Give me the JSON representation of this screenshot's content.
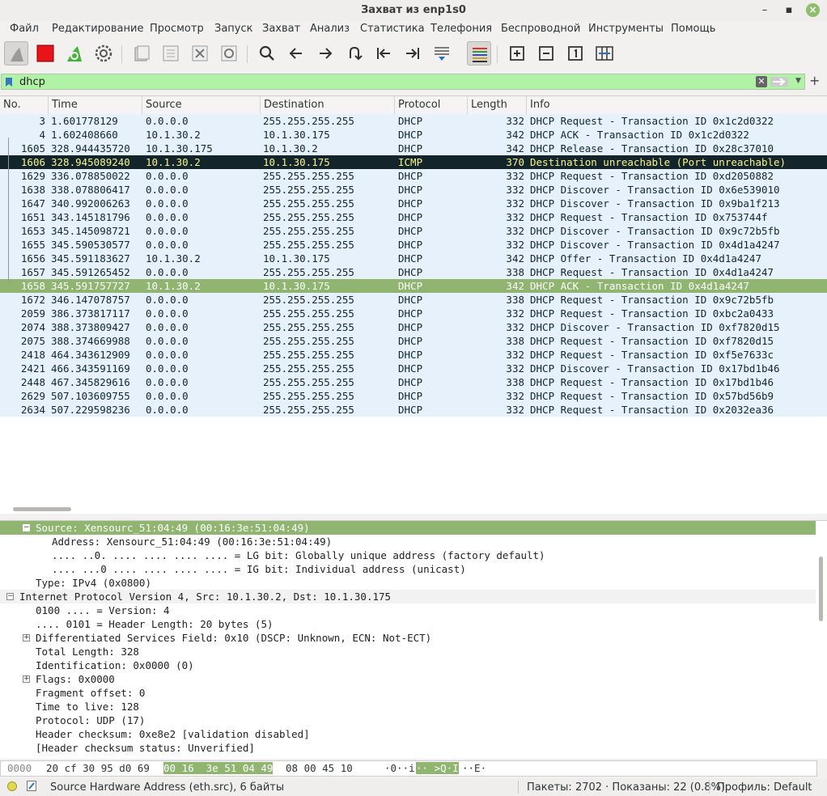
{
  "window": {
    "title": "Захват из enp1s0",
    "min": "–",
    "max": "▪",
    "close": "×"
  },
  "menu": [
    "Файл",
    "Редактирование",
    "Просмотр",
    "Запуск",
    "Захват",
    "Анализ",
    "Статистика",
    "Телефония",
    "Беспроводной",
    "Инструменты",
    "Помощь"
  ],
  "filter": {
    "value": "dhcp",
    "clear": "✕"
  },
  "packet_list": {
    "columns": [
      "No.",
      "Time",
      "Source",
      "Destination",
      "Protocol",
      "Length",
      "Info"
    ],
    "rows": [
      {
        "no": "3",
        "time": "1.601778129",
        "src": "0.0.0.0",
        "dst": "255.255.255.255",
        "proto": "DHCP",
        "len": "332",
        "info": "DHCP Request  - Transaction ID 0x1c2d0322"
      },
      {
        "no": "4",
        "time": "1.602408660",
        "src": "10.1.30.2",
        "dst": "10.1.30.175",
        "proto": "DHCP",
        "len": "342",
        "info": "DHCP ACK      - Transaction ID 0x1c2d0322"
      },
      {
        "no": "1605",
        "time": "328.944435720",
        "src": "10.1.30.175",
        "dst": "10.1.30.2",
        "proto": "DHCP",
        "len": "342",
        "info": "DHCP Release  - Transaction ID 0x28c37010"
      },
      {
        "no": "1606",
        "time": "328.945089240",
        "src": "10.1.30.2",
        "dst": "10.1.30.175",
        "proto": "ICMP",
        "len": "370",
        "info": "Destination unreachable (Port unreachable)"
      },
      {
        "no": "1629",
        "time": "336.078850022",
        "src": "0.0.0.0",
        "dst": "255.255.255.255",
        "proto": "DHCP",
        "len": "332",
        "info": "DHCP Request  - Transaction ID 0xd2050882"
      },
      {
        "no": "1638",
        "time": "338.078806417",
        "src": "0.0.0.0",
        "dst": "255.255.255.255",
        "proto": "DHCP",
        "len": "332",
        "info": "DHCP Discover - Transaction ID 0x6e539010"
      },
      {
        "no": "1647",
        "time": "340.992006263",
        "src": "0.0.0.0",
        "dst": "255.255.255.255",
        "proto": "DHCP",
        "len": "332",
        "info": "DHCP Discover - Transaction ID 0x9ba1f213"
      },
      {
        "no": "1651",
        "time": "343.145181796",
        "src": "0.0.0.0",
        "dst": "255.255.255.255",
        "proto": "DHCP",
        "len": "332",
        "info": "DHCP Request  - Transaction ID 0x753744f"
      },
      {
        "no": "1653",
        "time": "345.145098721",
        "src": "0.0.0.0",
        "dst": "255.255.255.255",
        "proto": "DHCP",
        "len": "332",
        "info": "DHCP Discover - Transaction ID 0x9c72b5fb"
      },
      {
        "no": "1655",
        "time": "345.590530577",
        "src": "0.0.0.0",
        "dst": "255.255.255.255",
        "proto": "DHCP",
        "len": "332",
        "info": "DHCP Discover - Transaction ID 0x4d1a4247"
      },
      {
        "no": "1656",
        "time": "345.591183627",
        "src": "10.1.30.2",
        "dst": "10.1.30.175",
        "proto": "DHCP",
        "len": "342",
        "info": "DHCP Offer    - Transaction ID 0x4d1a4247"
      },
      {
        "no": "1657",
        "time": "345.591265452",
        "src": "0.0.0.0",
        "dst": "255.255.255.255",
        "proto": "DHCP",
        "len": "338",
        "info": "DHCP Request  - Transaction ID 0x4d1a4247"
      },
      {
        "no": "1658",
        "time": "345.591757727",
        "src": "10.1.30.2",
        "dst": "10.1.30.175",
        "proto": "DHCP",
        "len": "342",
        "info": "DHCP ACK      - Transaction ID 0x4d1a4247"
      },
      {
        "no": "1672",
        "time": "346.147078757",
        "src": "0.0.0.0",
        "dst": "255.255.255.255",
        "proto": "DHCP",
        "len": "338",
        "info": "DHCP Request  - Transaction ID 0x9c72b5fb"
      },
      {
        "no": "2059",
        "time": "386.373817117",
        "src": "0.0.0.0",
        "dst": "255.255.255.255",
        "proto": "DHCP",
        "len": "332",
        "info": "DHCP Request  - Transaction ID 0xbc2a0433"
      },
      {
        "no": "2074",
        "time": "388.373809427",
        "src": "0.0.0.0",
        "dst": "255.255.255.255",
        "proto": "DHCP",
        "len": "332",
        "info": "DHCP Discover - Transaction ID 0xf7820d15"
      },
      {
        "no": "2075",
        "time": "388.374669988",
        "src": "0.0.0.0",
        "dst": "255.255.255.255",
        "proto": "DHCP",
        "len": "338",
        "info": "DHCP Request  - Transaction ID 0xf7820d15"
      },
      {
        "no": "2418",
        "time": "464.343612909",
        "src": "0.0.0.0",
        "dst": "255.255.255.255",
        "proto": "DHCP",
        "len": "332",
        "info": "DHCP Request  - Transaction ID 0xf5e7633c"
      },
      {
        "no": "2421",
        "time": "466.343591169",
        "src": "0.0.0.0",
        "dst": "255.255.255.255",
        "proto": "DHCP",
        "len": "332",
        "info": "DHCP Discover - Transaction ID 0x17bd1b46"
      },
      {
        "no": "2448",
        "time": "467.345829616",
        "src": "0.0.0.0",
        "dst": "255.255.255.255",
        "proto": "DHCP",
        "len": "338",
        "info": "DHCP Request  - Transaction ID 0x17bd1b46"
      },
      {
        "no": "2629",
        "time": "507.103609755",
        "src": "0.0.0.0",
        "dst": "255.255.255.255",
        "proto": "DHCP",
        "len": "332",
        "info": "DHCP Request  - Transaction ID 0x57bd56b9"
      },
      {
        "no": "2634",
        "time": "507.229598236",
        "src": "0.0.0.0",
        "dst": "255.255.255.255",
        "proto": "DHCP",
        "len": "332",
        "info": "DHCP Request  - Transaction ID 0x2032ea36"
      }
    ]
  },
  "details": [
    {
      "text": "Source: Xensourc_51:04:49 (00:16:3e:51:04:49)",
      "expander": "−"
    },
    {
      "text": "Address: Xensourc_51:04:49 (00:16:3e:51:04:49)",
      "expander": ""
    },
    {
      "text": ".... ..0. .... .... .... .... = LG bit: Globally unique address (factory default)",
      "expander": ""
    },
    {
      "text": ".... ...0 .... .... .... .... = IG bit: Individual address (unicast)",
      "expander": ""
    },
    {
      "text": "Type: IPv4 (0x0800)",
      "expander": ""
    },
    {
      "text": "Internet Protocol Version 4, Src: 10.1.30.2, Dst: 10.1.30.175",
      "expander": "−"
    },
    {
      "text": "0100 .... = Version: 4",
      "expander": ""
    },
    {
      "text": ".... 0101 = Header Length: 20 bytes (5)",
      "expander": ""
    },
    {
      "text": "Differentiated Services Field: 0x10 (DSCP: Unknown, ECN: Not-ECT)",
      "expander": "+"
    },
    {
      "text": "Total Length: 328",
      "expander": ""
    },
    {
      "text": "Identification: 0x0000 (0)",
      "expander": ""
    },
    {
      "text": "Flags: 0x0000",
      "expander": "+"
    },
    {
      "text": "Fragment offset: 0",
      "expander": ""
    },
    {
      "text": "Time to live: 128",
      "expander": ""
    },
    {
      "text": "Protocol: UDP (17)",
      "expander": ""
    },
    {
      "text": "Header checksum: 0xe8e2 [validation disabled]",
      "expander": ""
    },
    {
      "text": "[Header checksum status: Unverified]",
      "expander": ""
    }
  ],
  "hex": {
    "offset": "0000",
    "bytes_pre": "20 cf 30 95 d0 69",
    "bytes_hl": "00 16  3e 51 04 49",
    "bytes_post": "08 00 45 10",
    "ascii_pre": "·0··i·",
    "ascii_hl": "·· >Q·I",
    "ascii_post": "··E·"
  },
  "status": {
    "field": "Source Hardware Address (eth.src), 6 байты",
    "packets": "Пакеты: 2702 · Показаны: 22 (0.8%)",
    "profile": "Профиль: Default"
  },
  "colors": {
    "selected_row": "#14242b",
    "ack_row": "#8fb571",
    "dhcp_row": "#e7f1fc",
    "filter_ok": "#b2f2a6"
  }
}
